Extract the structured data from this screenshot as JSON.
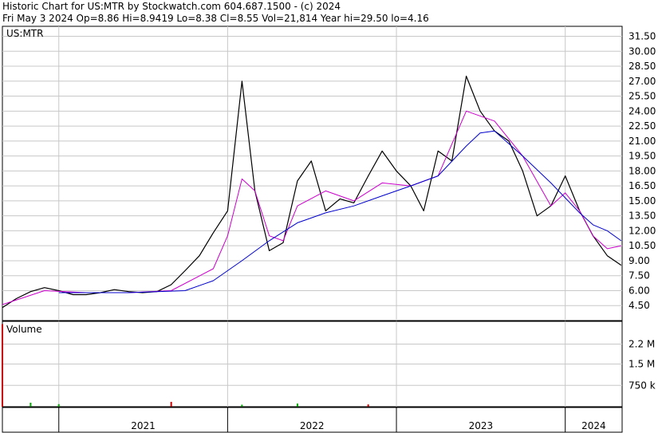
{
  "header": {
    "line1": "Historic Chart for US:MTR by Stockwatch.com 604.687.1500 - (c) 2024",
    "line2": "Fri May  3 2024  Op=8.86  Hi=8.9419  Lo=8.38  Cl=8.55  Vol=21,814  Year hi=29.50  lo=4.16"
  },
  "chart_data": [
    {
      "type": "line",
      "panel": "price",
      "title": "US:MTR",
      "ylim": [
        3.0,
        32.5
      ],
      "yticks": [
        "31.50",
        "30.00",
        "28.50",
        "27.00",
        "25.50",
        "24.00",
        "22.50",
        "21.00",
        "19.50",
        "18.00",
        "16.50",
        "15.00",
        "13.50",
        "12.00",
        "10.50",
        "9.00",
        "7.50",
        "6.00",
        "4.50"
      ],
      "x_labels": [
        "2021",
        "2022",
        "2023",
        "2024"
      ],
      "grid": true,
      "colors": {
        "price": "#000000",
        "ma_short": "#cc00cc",
        "ma_long": "#0000cc",
        "grid": "#c8c8c8"
      },
      "series": [
        {
          "role": "price",
          "x": [
            "2020-09",
            "2020-10",
            "2020-11",
            "2020-12",
            "2021-01",
            "2021-02",
            "2021-03",
            "2021-04",
            "2021-05",
            "2021-06",
            "2021-07",
            "2021-08",
            "2021-09",
            "2021-10",
            "2021-11",
            "2021-12",
            "2022-01",
            "2022-02",
            "2022-03",
            "2022-04",
            "2022-05",
            "2022-06",
            "2022-07",
            "2022-08",
            "2022-09",
            "2022-10",
            "2022-11",
            "2022-12",
            "2023-01",
            "2023-02",
            "2023-03",
            "2023-04",
            "2023-05",
            "2023-06",
            "2023-07",
            "2023-08",
            "2023-09",
            "2023-10",
            "2023-11",
            "2023-12",
            "2024-01",
            "2024-02",
            "2024-03",
            "2024-04",
            "2024-05"
          ],
          "values": [
            4.3,
            5.2,
            5.9,
            6.3,
            6.0,
            5.6,
            5.6,
            5.8,
            6.1,
            5.9,
            5.8,
            5.9,
            6.6,
            8.0,
            9.5,
            11.8,
            14.0,
            27.0,
            16.0,
            10.0,
            10.8,
            17.0,
            19.0,
            14.0,
            15.2,
            14.8,
            17.5,
            20.0,
            18.0,
            16.5,
            14.0,
            20.0,
            19.0,
            27.5,
            24.0,
            22.0,
            21.0,
            18.0,
            13.5,
            14.5,
            17.5,
            14.0,
            11.5,
            9.5,
            8.55
          ]
        },
        {
          "role": "ma_short",
          "x": [
            "2020-09",
            "2020-12",
            "2021-03",
            "2021-06",
            "2021-09",
            "2021-12",
            "2022-01",
            "2022-02",
            "2022-03",
            "2022-04",
            "2022-05",
            "2022-06",
            "2022-08",
            "2022-10",
            "2022-12",
            "2023-02",
            "2023-04",
            "2023-06",
            "2023-08",
            "2023-10",
            "2023-12",
            "2024-01",
            "2024-02",
            "2024-03",
            "2024-04",
            "2024-05"
          ],
          "values": [
            4.6,
            6.0,
            5.8,
            5.8,
            6.0,
            8.2,
            11.5,
            17.2,
            16.0,
            11.5,
            11.0,
            14.5,
            16.0,
            15.0,
            16.8,
            16.5,
            17.5,
            24.0,
            23.0,
            19.5,
            14.5,
            15.8,
            14.0,
            11.5,
            10.2,
            10.5
          ]
        },
        {
          "role": "ma_long",
          "x": [
            "2021-01",
            "2021-06",
            "2021-10",
            "2021-12",
            "2022-02",
            "2022-04",
            "2022-06",
            "2022-08",
            "2022-10",
            "2022-12",
            "2023-02",
            "2023-04",
            "2023-06",
            "2023-07",
            "2023-08",
            "2023-10",
            "2023-12",
            "2024-02",
            "2024-03",
            "2024-04",
            "2024-05"
          ],
          "values": [
            5.8,
            5.8,
            6.0,
            7.0,
            9.0,
            11.0,
            12.8,
            13.8,
            14.5,
            15.5,
            16.5,
            17.5,
            20.5,
            21.8,
            22.0,
            19.5,
            16.8,
            13.8,
            12.6,
            12.0,
            11.0
          ]
        }
      ]
    },
    {
      "type": "bar",
      "panel": "volume",
      "title": "Volume",
      "ylim": [
        0,
        3000000
      ],
      "yticks": [
        "2.2 M",
        "1.5 M",
        "750 k"
      ],
      "bars": [
        {
          "x": "2020-09",
          "value": 2900000,
          "color": "#cc0000"
        },
        {
          "x": "2020-11",
          "value": 140000,
          "color": "#00aa00"
        },
        {
          "x": "2021-01",
          "value": 90000,
          "color": "#00aa00"
        },
        {
          "x": "2021-09",
          "value": 170000,
          "color": "#cc0000"
        },
        {
          "x": "2022-02",
          "value": 70000,
          "color": "#00aa00"
        },
        {
          "x": "2022-06",
          "value": 110000,
          "color": "#00aa00"
        },
        {
          "x": "2022-11",
          "value": 80000,
          "color": "#cc0000"
        }
      ]
    }
  ]
}
